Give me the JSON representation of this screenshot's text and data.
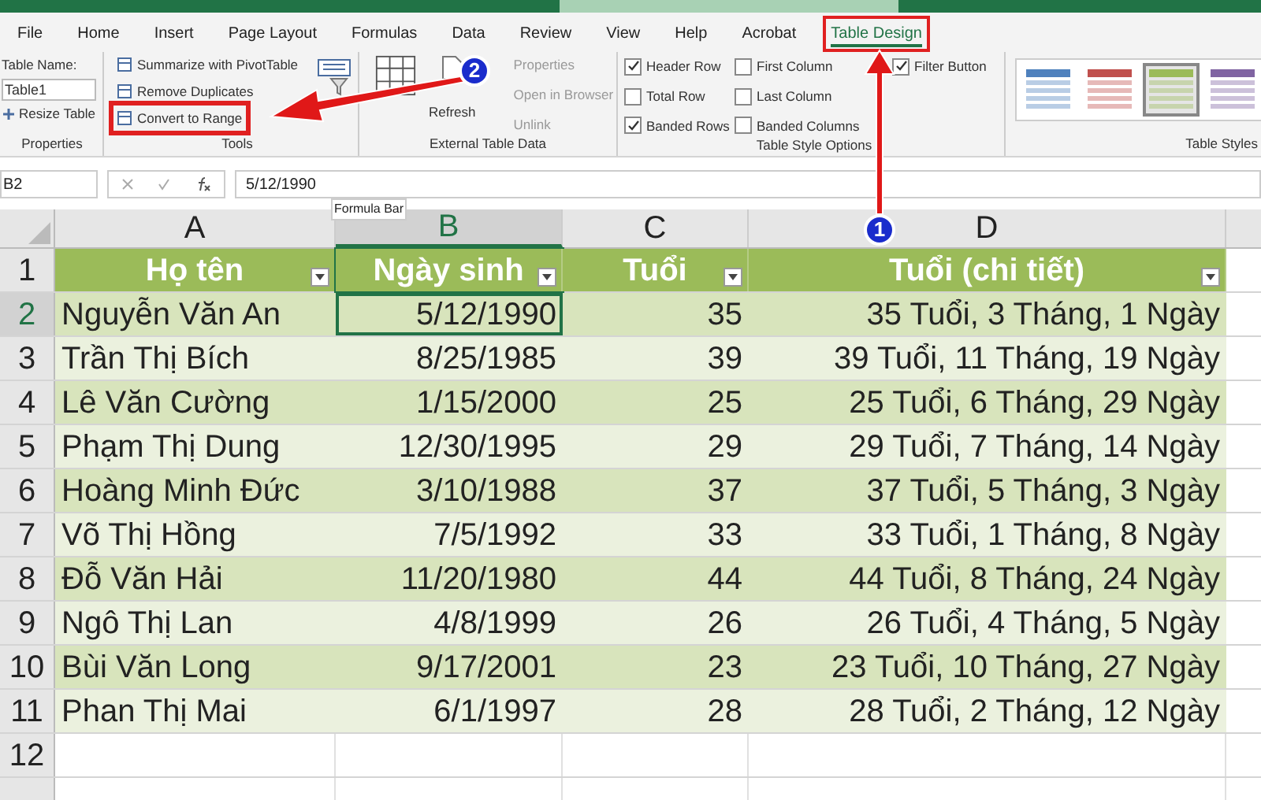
{
  "ribbon_tabs": [
    {
      "label": "File",
      "selected": false
    },
    {
      "label": "Home",
      "selected": false
    },
    {
      "label": "Insert",
      "selected": false
    },
    {
      "label": "Page Layout",
      "selected": false
    },
    {
      "label": "Formulas",
      "selected": false
    },
    {
      "label": "Data",
      "selected": false
    },
    {
      "label": "Review",
      "selected": false
    },
    {
      "label": "View",
      "selected": false
    },
    {
      "label": "Help",
      "selected": false
    },
    {
      "label": "Acrobat",
      "selected": false
    },
    {
      "label": "Table Design",
      "selected": true
    }
  ],
  "properties": {
    "table_name_label": "Table Name:",
    "table_name": "Table1",
    "resize": "Resize Table",
    "group": "Properties"
  },
  "tools": {
    "items": [
      {
        "label": "Summarize with PivotTable",
        "highlighted": false
      },
      {
        "label": "Remove Duplicates",
        "highlighted": false
      },
      {
        "label": "Convert to Range",
        "highlighted": true
      }
    ],
    "group": "Tools"
  },
  "external": {
    "refresh": "Refresh",
    "items": [
      {
        "label": "Properties",
        "disabled": true
      },
      {
        "label": "Open in Browser",
        "disabled": true
      },
      {
        "label": "Unlink",
        "disabled": true
      }
    ],
    "group": "External Table Data"
  },
  "style_options": {
    "options": [
      {
        "label": "Header Row",
        "checked": true
      },
      {
        "label": "First Column",
        "checked": false
      },
      {
        "label": "Filter Button",
        "checked": true
      },
      {
        "label": "Total Row",
        "checked": false
      },
      {
        "label": "Last Column",
        "checked": false
      },
      {
        "label": "Banded Rows",
        "checked": true
      },
      {
        "label": "Banded Columns",
        "checked": false
      }
    ],
    "group": "Table Style Options"
  },
  "table_styles": {
    "styles": [
      {
        "color": "#4f81bd",
        "selected": false
      },
      {
        "color": "#c0504d",
        "selected": false
      },
      {
        "color": "#9bbb59",
        "selected": true
      },
      {
        "color": "#8064a2",
        "selected": false
      }
    ],
    "group": "Table Styles"
  },
  "formula_bar": {
    "name_box": "B2",
    "value": "5/12/1990",
    "tooltip": "Formula Bar"
  },
  "sheet": {
    "columns": [
      {
        "label": "A",
        "selected": false
      },
      {
        "label": "B",
        "selected": true
      },
      {
        "label": "C",
        "selected": false
      },
      {
        "label": "D",
        "selected": false
      }
    ],
    "header": [
      "Họ tên",
      "Ngày sinh",
      "Tuổi",
      "Tuổi (chi tiết)"
    ],
    "rows": [
      [
        "Nguyễn Văn An",
        "5/12/1990",
        "35",
        "35 Tuổi, 3 Tháng, 1 Ngày"
      ],
      [
        "Trần Thị Bích",
        "8/25/1985",
        "39",
        "39 Tuổi, 11 Tháng, 19 Ngày"
      ],
      [
        "Lê Văn Cường",
        "1/15/2000",
        "25",
        "25 Tuổi, 6 Tháng, 29 Ngày"
      ],
      [
        "Phạm Thị Dung",
        "12/30/1995",
        "29",
        "29 Tuổi, 7 Tháng, 14 Ngày"
      ],
      [
        "Hoàng Minh Đức",
        "3/10/1988",
        "37",
        "37 Tuổi, 5 Tháng, 3 Ngày"
      ],
      [
        "Võ Thị Hồng",
        "7/5/1992",
        "33",
        "33 Tuổi, 1 Tháng, 8 Ngày"
      ],
      [
        "Đỗ Văn Hải",
        "11/20/1980",
        "44",
        "44 Tuổi, 8 Tháng, 24 Ngày"
      ],
      [
        "Ngô Thị Lan",
        "4/8/1999",
        "26",
        "26 Tuổi, 4 Tháng, 5 Ngày"
      ],
      [
        "Bùi Văn Long",
        "9/17/2001",
        "23",
        "23 Tuổi, 10 Tháng, 27 Ngày"
      ],
      [
        "Phan Thị Mai",
        "6/1/1997",
        "28",
        "28 Tuổi, 2 Tháng, 12 Ngày"
      ]
    ],
    "row_numbers": [
      {
        "label": "1",
        "selected": false
      },
      {
        "label": "2",
        "selected": true
      },
      {
        "label": "3",
        "selected": false
      },
      {
        "label": "4",
        "selected": false
      },
      {
        "label": "5",
        "selected": false
      },
      {
        "label": "6",
        "selected": false
      },
      {
        "label": "7",
        "selected": false
      },
      {
        "label": "8",
        "selected": false
      },
      {
        "label": "9",
        "selected": false
      },
      {
        "label": "10",
        "selected": false
      },
      {
        "label": "11",
        "selected": false
      },
      {
        "label": "12",
        "selected": false
      }
    ]
  },
  "annotations": [
    {
      "badge": "1"
    },
    {
      "badge": "2"
    }
  ]
}
